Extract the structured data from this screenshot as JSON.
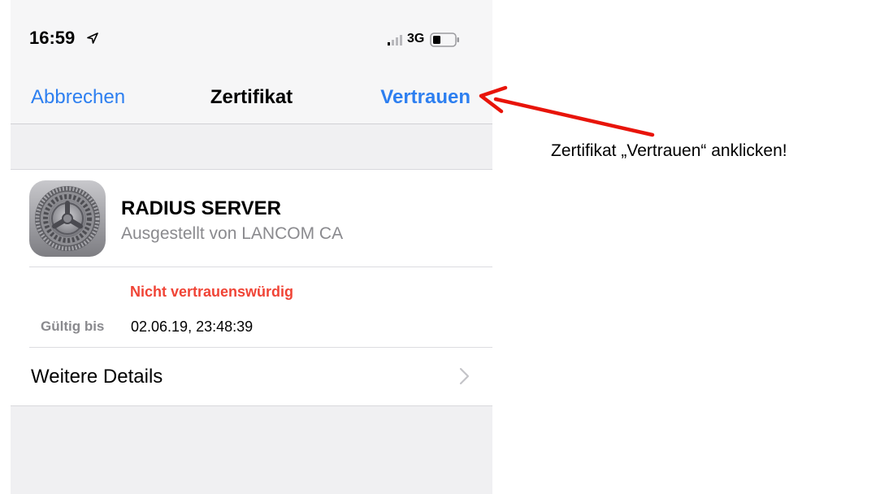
{
  "status_bar": {
    "time": "16:59",
    "network": "3G",
    "icons": [
      "location-arrow-icon",
      "signal-icon",
      "battery-icon"
    ]
  },
  "nav": {
    "cancel_label": "Abbrechen",
    "title": "Zertifikat",
    "trust_label": "Vertrauen"
  },
  "certificate": {
    "icon": "settings-gear-icon",
    "name": "RADIUS SERVER",
    "issuer": "Ausgestellt von LANCOM CA",
    "trust_status": "Nicht vertrauenswürdig",
    "valid_label": "Gültig bis",
    "valid_value": "02.06.19, 23:48:39",
    "details_label": "Weitere Details"
  },
  "annotation": {
    "text": "Zertifikat „Vertrauen“ anklicken!"
  },
  "colors": {
    "accent": "#2d7ff0",
    "danger": "#f04436",
    "arrow": "#e8140a",
    "secondary_text": "#8a8a8e",
    "background": "#f0f0f2"
  }
}
